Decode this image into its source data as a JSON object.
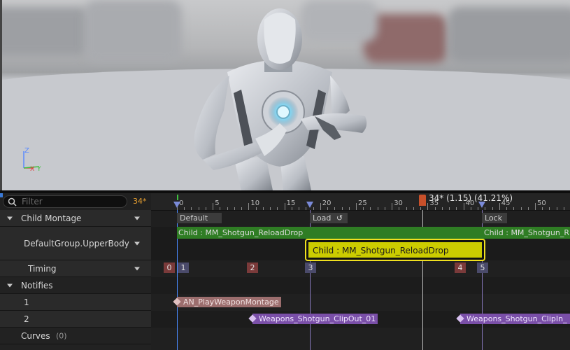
{
  "viewport": {
    "axis": {
      "z": "Z",
      "x": "X",
      "y": "Y"
    }
  },
  "filter": {
    "placeholder": "Filter",
    "current_frame": "34*"
  },
  "tree": {
    "child_montage": "Child Montage",
    "slot": "DefaultGroup.UpperBody",
    "timing": "Timing",
    "notifies": "Notifies",
    "track1": "1",
    "track2": "2",
    "curves": "Curves",
    "curves_count": "(0)"
  },
  "ruler": {
    "ticks": [
      "0",
      "5",
      "10",
      "15",
      "20",
      "25",
      "30",
      "35",
      "40",
      "45",
      "50"
    ],
    "scrubber_label": "34* (1.15) (41.21%)"
  },
  "sections": {
    "default": "Default",
    "load": "Load",
    "lock": "Lock"
  },
  "montage": {
    "segment_a": "Child : MM_Shotgun_ReloadDrop",
    "segment_b": "Child : MM_Shotgun_ReloadDrop",
    "segment_c": "Child : MM_Shotgun_R",
    "selected": "Child : MM_Shotgun_ReloadDrop"
  },
  "timing_markers": [
    "0",
    "1",
    "2",
    "3",
    "4",
    "5"
  ],
  "notify_events": {
    "a": "AN_PlayWeaponMontage",
    "b": "Weapons_Shotgun_ClipOut_01",
    "c": "Weapons_Shotgun_ClipIn_"
  },
  "colors": {
    "accent": "#e8a030",
    "green_bar": "#2f7d24",
    "selected_yellow": "#cccc00",
    "notify_pink": "#a07070",
    "notify_purple": "#8a5ab8"
  }
}
